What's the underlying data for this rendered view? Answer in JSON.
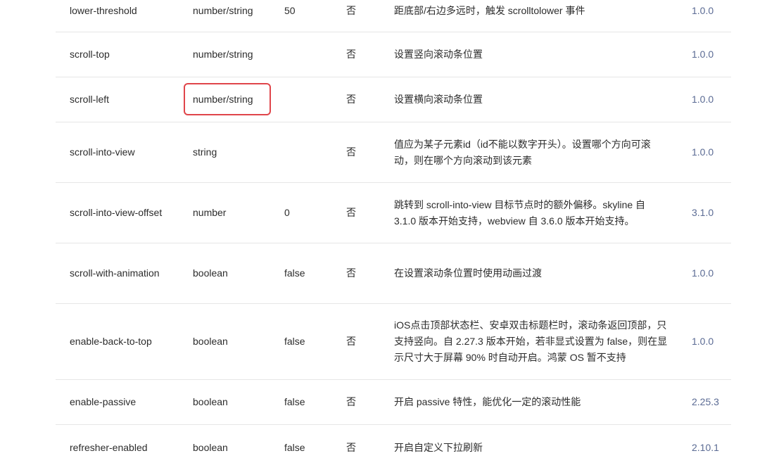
{
  "rows": [
    {
      "name": "lower-threshold",
      "type": "number/string",
      "default": "50",
      "required": "否",
      "description": "距底部/右边多远时，触发 scrolltolower 事件",
      "version": "1.0.0"
    },
    {
      "name": "scroll-top",
      "type": "number/string",
      "default": "",
      "required": "否",
      "description": "设置竖向滚动条位置",
      "version": "1.0.0"
    },
    {
      "name": "scroll-left",
      "type": "number/string",
      "default": "",
      "required": "否",
      "description": "设置横向滚动条位置",
      "version": "1.0.0"
    },
    {
      "name": "scroll-into-view",
      "type": "string",
      "default": "",
      "required": "否",
      "description": "值应为某子元素id（id不能以数字开头）。设置哪个方向可滚动，则在哪个方向滚动到该元素",
      "version": "1.0.0"
    },
    {
      "name": "scroll-into-view-offset",
      "type": "number",
      "default": "0",
      "required": "否",
      "description": "跳转到 scroll-into-view 目标节点时的额外偏移。skyline 自 3.1.0 版本开始支持，webview 自 3.6.0 版本开始支持。",
      "version": "3.1.0"
    },
    {
      "name": "scroll-with-animation",
      "type": "boolean",
      "default": "false",
      "required": "否",
      "description": "在设置滚动条位置时使用动画过渡",
      "version": "1.0.0"
    },
    {
      "name": "enable-back-to-top",
      "type": "boolean",
      "default": "false",
      "required": "否",
      "description": "iOS点击顶部状态栏、安卓双击标题栏时，滚动条返回顶部，只支持竖向。自 2.27.3 版本开始，若非显式设置为 false，则在显示尺寸大于屏幕 90% 时自动开启。鸿蒙 OS 暂不支持",
      "version": "1.0.0"
    },
    {
      "name": "enable-passive",
      "type": "boolean",
      "default": "false",
      "required": "否",
      "description": "开启 passive 特性，能优化一定的滚动性能",
      "version": "2.25.3"
    },
    {
      "name": "refresher-enabled",
      "type": "boolean",
      "default": "false",
      "required": "否",
      "description": "开启自定义下拉刷新",
      "version": "2.10.1"
    }
  ]
}
